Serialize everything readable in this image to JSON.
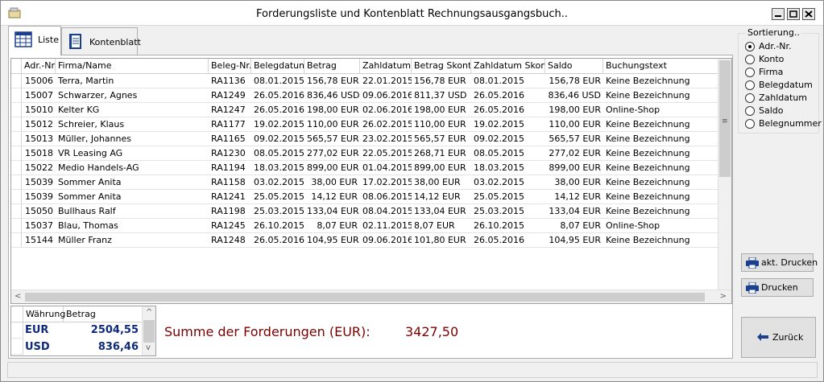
{
  "window": {
    "title": "Forderungsliste und Kontenblatt Rechnungsausgangsbuch.."
  },
  "tabs": [
    {
      "label": "Liste",
      "icon": "table-grid-icon",
      "active": true
    },
    {
      "label": "Kontenblatt",
      "icon": "ledger-book-icon",
      "active": false
    }
  ],
  "table": {
    "columns": [
      "Adr.-Nr.",
      "Firma/Name",
      "Beleg-Nr.",
      "Belegdatum",
      "Betrag",
      "Zahldatum",
      "Betrag Skonto",
      "Zahldatum Skonto",
      "Saldo",
      "Buchungstext"
    ],
    "rows": [
      [
        "15006",
        "Terra, Martin",
        "RA1136",
        "08.01.2015",
        "156,78 EUR",
        "22.01.2015",
        "156,78 EUR",
        "08.01.2015",
        "156,78 EUR",
        "Keine Bezeichnung"
      ],
      [
        "15007",
        "Schwarzer, Agnes",
        "RA1249",
        "26.05.2016",
        "836,46 USD",
        "09.06.2016",
        "811,37 USD",
        "26.05.2016",
        "836,46 USD",
        "Keine Bezeichnung"
      ],
      [
        "15010",
        "Kelter KG",
        "RA1247",
        "26.05.2016",
        "198,00 EUR",
        "02.06.2016",
        "198,00 EUR",
        "26.05.2016",
        "198,00 EUR",
        "Online-Shop"
      ],
      [
        "15012",
        "Schreier, Klaus",
        "RA1177",
        "19.02.2015",
        "110,00 EUR",
        "26.02.2015",
        "110,00 EUR",
        "19.02.2015",
        "110,00 EUR",
        "Keine Bezeichnung"
      ],
      [
        "15013",
        "Müller, Johannes",
        "RA1165",
        "09.02.2015",
        "565,57 EUR",
        "23.02.2015",
        "565,57 EUR",
        "09.02.2015",
        "565,57 EUR",
        "Keine Bezeichnung"
      ],
      [
        "15018",
        "VR Leasing AG",
        "RA1230",
        "08.05.2015",
        "277,02 EUR",
        "22.05.2015",
        "268,71 EUR",
        "08.05.2015",
        "277,02 EUR",
        "Keine Bezeichnung"
      ],
      [
        "15022",
        "Medio Handels-AG",
        "RA1194",
        "18.03.2015",
        "899,00 EUR",
        "01.04.2015",
        "899,00 EUR",
        "18.03.2015",
        "899,00 EUR",
        "Keine Bezeichnung"
      ],
      [
        "15039",
        "Sommer Anita",
        "RA1158",
        "03.02.2015",
        "38,00 EUR",
        "17.02.2015",
        "38,00 EUR",
        "03.02.2015",
        "38,00 EUR",
        "Keine Bezeichnung"
      ],
      [
        "15039",
        "Sommer Anita",
        "RA1241",
        "25.05.2015",
        "14,12 EUR",
        "08.06.2015",
        "14,12 EUR",
        "25.05.2015",
        "14,12 EUR",
        "Keine Bezeichnung"
      ],
      [
        "15050",
        "Bullhaus Ralf",
        "RA1198",
        "25.03.2015",
        "133,04 EUR",
        "08.04.2015",
        "133,04 EUR",
        "25.03.2015",
        "133,04 EUR",
        "Keine Bezeichnung"
      ],
      [
        "15037",
        "Blau, Thomas",
        "RA1245",
        "26.10.2015",
        "8,07 EUR",
        "02.11.2015",
        "8,07 EUR",
        "26.10.2015",
        "8,07 EUR",
        "Online-Shop"
      ],
      [
        "15144",
        "Müller Franz",
        "RA1248",
        "26.05.2016",
        "104,95 EUR",
        "09.06.2016",
        "101,80 EUR",
        "26.05.2016",
        "104,95 EUR",
        "Keine Bezeichnung"
      ]
    ]
  },
  "currency_table": {
    "columns": [
      "Währung",
      "Betrag"
    ],
    "rows": [
      [
        "EUR",
        "2504,55"
      ],
      [
        "USD",
        "836,46"
      ]
    ]
  },
  "summary": {
    "label": "Summe der Forderungen (EUR):",
    "value": "3427,50"
  },
  "sorting": {
    "label": "Sortierung..",
    "options": [
      "Adr.-Nr.",
      "Konto",
      "Firma",
      "Belegdatum",
      "Zahldatum",
      "Saldo",
      "Belegnummer"
    ],
    "selected": "Adr.-Nr."
  },
  "buttons": {
    "print_current": "akt. Drucken",
    "print": "Drucken",
    "back": "Zurück"
  },
  "colors": {
    "summary_text": "#7b0000",
    "currency_text": "#0f2a7a"
  }
}
